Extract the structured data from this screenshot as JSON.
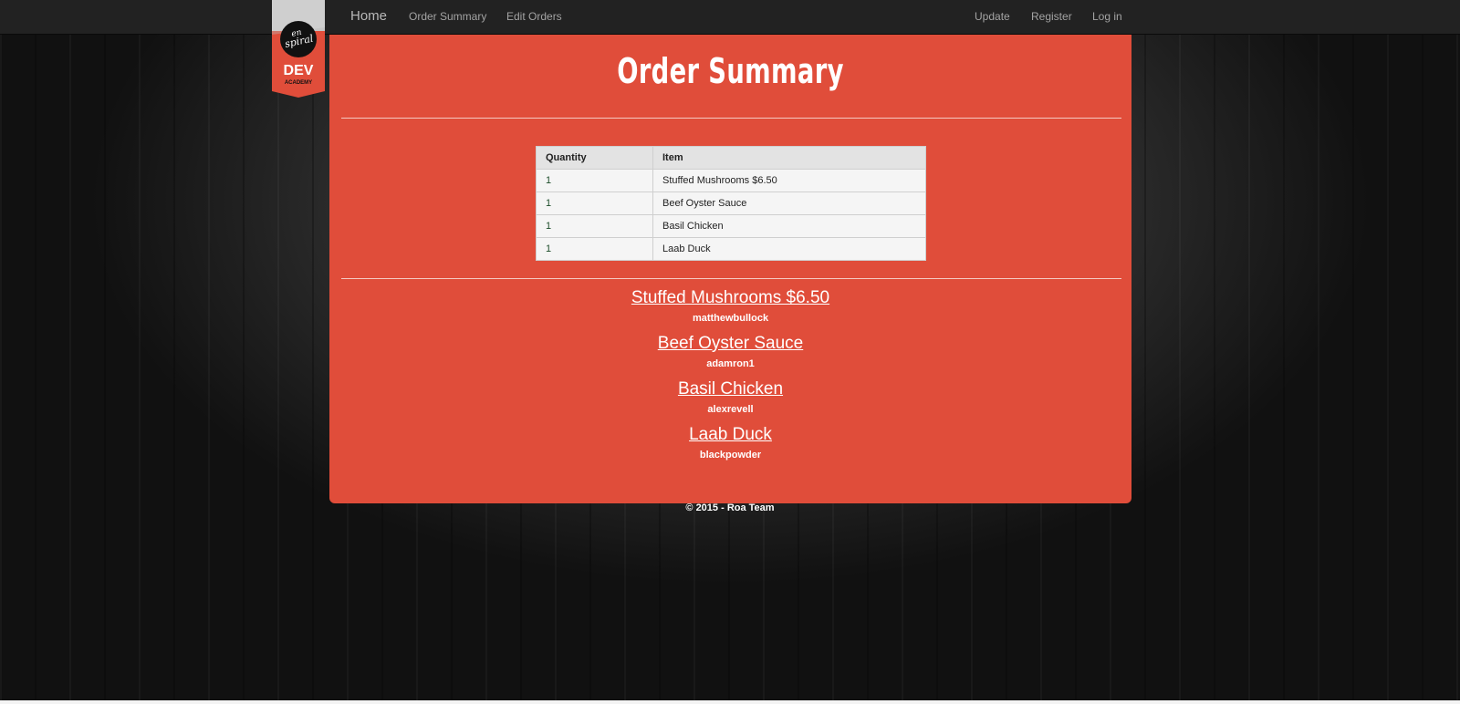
{
  "nav": {
    "brand": "Home",
    "order_summary": "Order Summary",
    "edit_orders": "Edit Orders",
    "update": "Update",
    "register": "Register",
    "login": "Log in"
  },
  "logo": {
    "line1": "en",
    "line2": "spiral",
    "dev": "DEV",
    "academy": "ACADEMY"
  },
  "page": {
    "title": "Order Summary"
  },
  "table": {
    "headers": [
      "Quantity",
      "Item"
    ],
    "rows": [
      {
        "quantity": "1",
        "item": "Stuffed Mushrooms $6.50"
      },
      {
        "quantity": "1",
        "item": "Beef Oyster Sauce"
      },
      {
        "quantity": "1",
        "item": "Basil Chicken"
      },
      {
        "quantity": "1",
        "item": "Laab Duck"
      }
    ]
  },
  "orders": [
    {
      "item": "Stuffed Mushrooms $6.50",
      "user": "matthewbullock"
    },
    {
      "item": "Beef Oyster Sauce",
      "user": "adamron1"
    },
    {
      "item": "Basil Chicken",
      "user": "alexrevell"
    },
    {
      "item": "Laab Duck",
      "user": "blackpowder"
    }
  ],
  "footer": {
    "text": "© 2015 - Roa Team"
  },
  "colors": {
    "accent": "#e04d3a",
    "navbar": "#222222",
    "logo_bg": "#e04d3a",
    "logo_band": "#cfcfcf"
  }
}
